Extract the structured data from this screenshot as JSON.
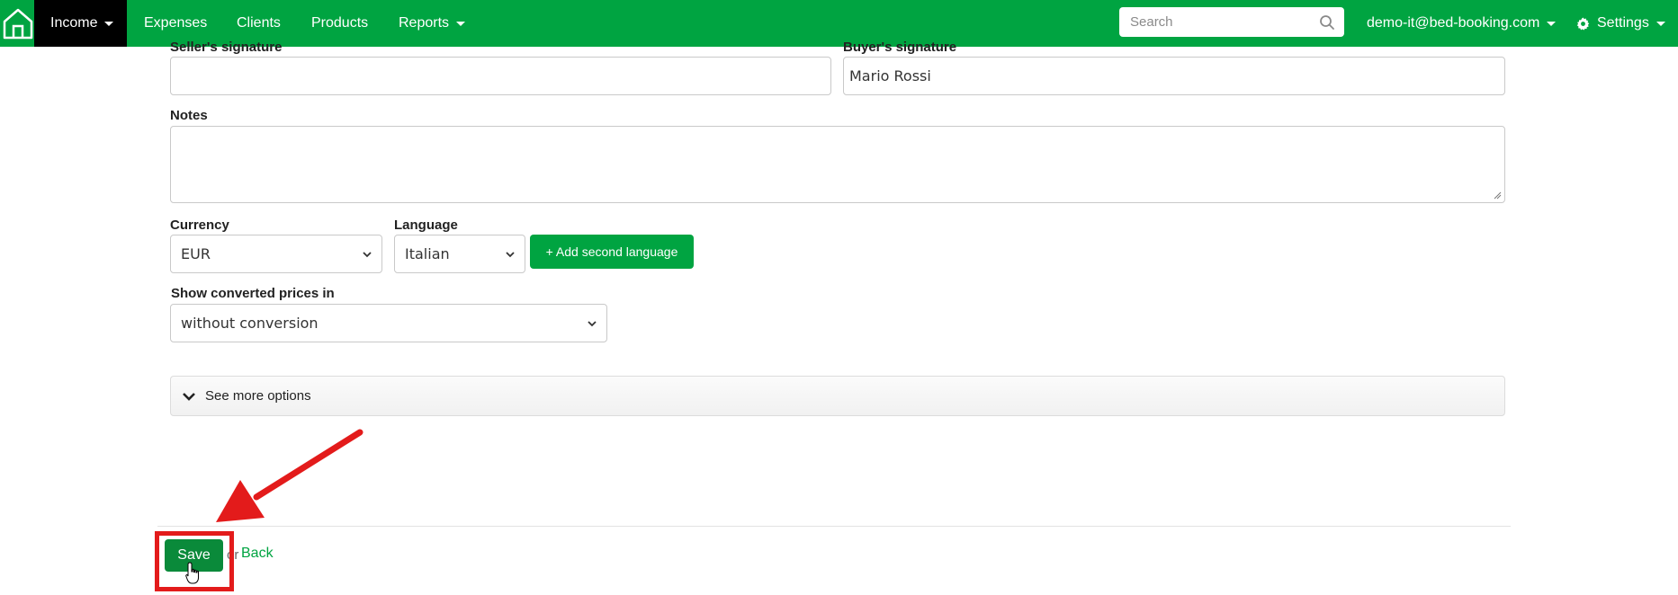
{
  "navbar": {
    "items": [
      {
        "label": "Income",
        "has_caret": true,
        "active": true
      },
      {
        "label": "Expenses",
        "has_caret": false
      },
      {
        "label": "Clients",
        "has_caret": false
      },
      {
        "label": "Products",
        "has_caret": false
      },
      {
        "label": "Reports",
        "has_caret": true
      }
    ],
    "search": {
      "placeholder": "Search",
      "value": ""
    },
    "user": {
      "label": "demo-it@bed-booking.com"
    },
    "settings": {
      "label": "Settings"
    },
    "brand_color": "#00a441"
  },
  "form": {
    "seller_signature": {
      "label": "Seller's signature",
      "value": ""
    },
    "buyer_signature": {
      "label": "Buyer's signature",
      "value": "Mario Rossi"
    },
    "notes": {
      "label": "Notes",
      "value": ""
    },
    "currency": {
      "label": "Currency",
      "selected": "EUR"
    },
    "language": {
      "label": "Language",
      "selected": "Italian"
    },
    "add_second_language": {
      "label": "+ Add second language"
    },
    "converted_prices": {
      "label": "Show converted prices in",
      "selected": "without conversion"
    },
    "more_options": {
      "label": "See more options"
    }
  },
  "actions": {
    "save": {
      "label": "Save"
    },
    "or": {
      "label": "or"
    },
    "back": {
      "label": "Back"
    }
  },
  "annotation": {
    "color": "#e31b1b"
  }
}
